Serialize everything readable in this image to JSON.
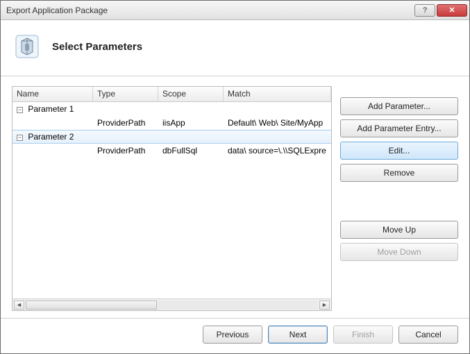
{
  "window": {
    "title": "Export Application Package"
  },
  "header": {
    "title": "Select Parameters"
  },
  "columns": {
    "name": "Name",
    "type": "Type",
    "scope": "Scope",
    "match": "Match"
  },
  "params": [
    {
      "name": "Parameter 1",
      "expanded": true,
      "selected": false,
      "row": {
        "type": "ProviderPath",
        "scope": "iisApp",
        "match": "Default\\ Web\\ Site/MyApp"
      }
    },
    {
      "name": "Parameter 2",
      "expanded": true,
      "selected": true,
      "row": {
        "type": "ProviderPath",
        "scope": "dbFullSql",
        "match": "data\\ source=\\.\\\\SQLExpre"
      }
    }
  ],
  "sideButtons": {
    "addParam": "Add Parameter...",
    "addEntry": "Add Parameter Entry...",
    "edit": "Edit...",
    "remove": "Remove",
    "moveUp": "Move Up",
    "moveDown": "Move Down"
  },
  "footer": {
    "previous": "Previous",
    "next": "Next",
    "finish": "Finish",
    "cancel": "Cancel"
  },
  "glyphs": {
    "help": "?",
    "close": "✕",
    "minus": "−",
    "left": "◄",
    "right": "►"
  }
}
